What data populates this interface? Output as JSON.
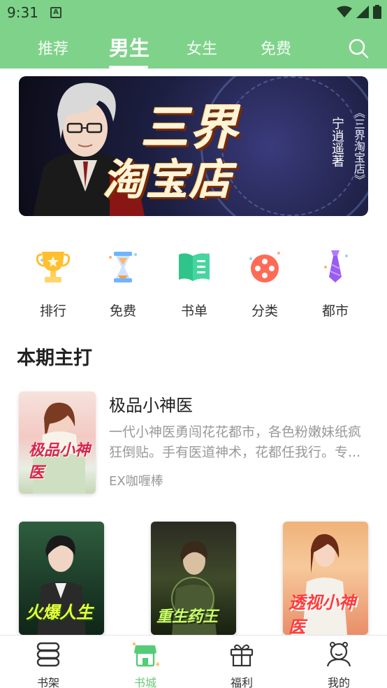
{
  "status_bar": {
    "time": "9:31",
    "notification_icon": "A"
  },
  "tabs": [
    {
      "label": "推荐",
      "active": false
    },
    {
      "label": "男生",
      "active": true
    },
    {
      "label": "女生",
      "active": false
    },
    {
      "label": "免费",
      "active": false
    }
  ],
  "banner": {
    "title_line1": "三界",
    "title_line2": "淘宝店",
    "author": "宁逍遥著",
    "book_title": "《三界淘宝店》"
  },
  "categories": [
    {
      "label": "排行",
      "icon": "trophy-icon"
    },
    {
      "label": "免费",
      "icon": "hourglass-icon"
    },
    {
      "label": "书单",
      "icon": "book-list-icon"
    },
    {
      "label": "分类",
      "icon": "category-icon"
    },
    {
      "label": "都市",
      "icon": "tie-icon"
    }
  ],
  "section": {
    "title": "本期主打"
  },
  "featured_book": {
    "title": "极品小神医",
    "description": "一代小神医勇闯花花都市，各色粉嫩妹纸疯狂倒贴。手有医道神术，花都任我行。专...",
    "author": "EX咖喱棒",
    "cover_title": "极品小神医"
  },
  "book_covers": [
    {
      "cover_text": "火爆人生"
    },
    {
      "cover_text": "重生药王"
    },
    {
      "cover_text": "透视小神医"
    }
  ],
  "bottom_nav": [
    {
      "label": "书架",
      "icon": "bookshelf-icon",
      "active": false
    },
    {
      "label": "书城",
      "icon": "bookstore-icon",
      "active": true
    },
    {
      "label": "福利",
      "icon": "gift-icon",
      "active": false
    },
    {
      "label": "我的",
      "icon": "profile-icon",
      "active": false
    }
  ],
  "colors": {
    "accent": "#7fd28a",
    "active_nav": "#6cc877",
    "muted_text": "#999999"
  }
}
